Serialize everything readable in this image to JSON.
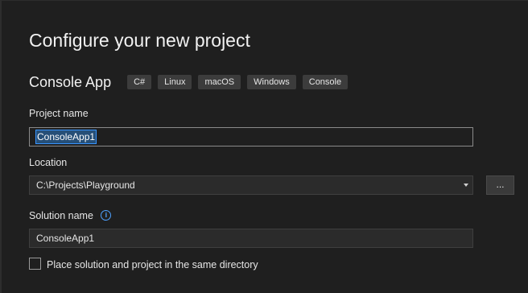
{
  "page": {
    "title": "Configure your new project"
  },
  "template": {
    "name": "Console App",
    "tags": [
      "C#",
      "Linux",
      "macOS",
      "Windows",
      "Console"
    ]
  },
  "project_name": {
    "label": "Project name",
    "value": "ConsoleApp1"
  },
  "location": {
    "label": "Location",
    "value": "C:\\Projects\\Playground",
    "browse_label": "..."
  },
  "solution_name": {
    "label": "Solution name",
    "value": "ConsoleApp1",
    "info_icon": "info-icon"
  },
  "same_directory": {
    "label": "Place solution and project in the same directory",
    "checked": false
  },
  "colors": {
    "background": "#1f1f1f",
    "selection": "#264f78",
    "accent": "#3794ff"
  }
}
